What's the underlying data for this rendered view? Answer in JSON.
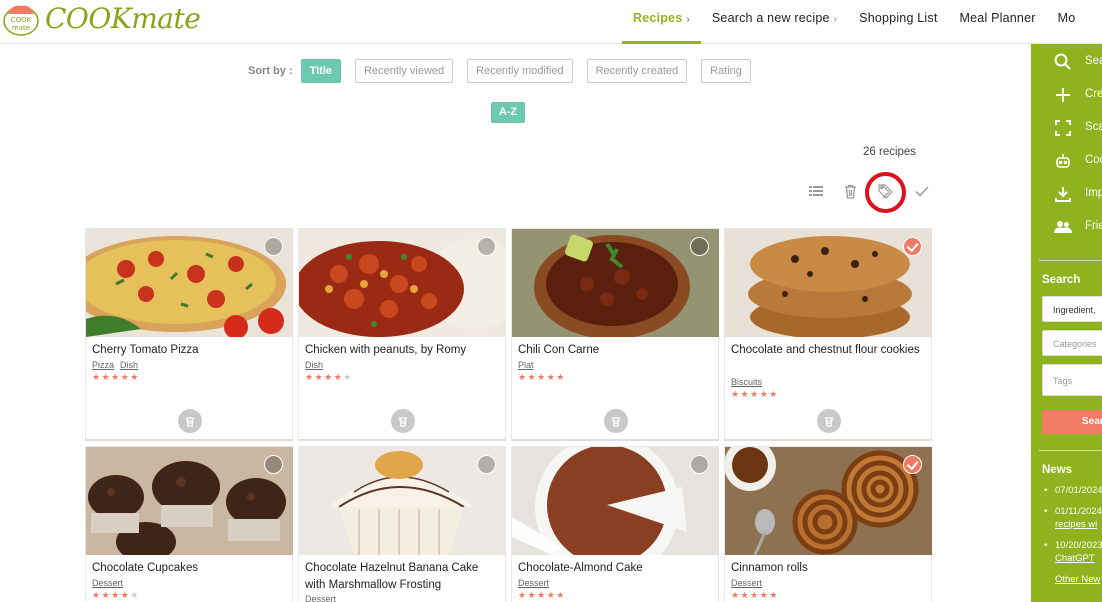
{
  "logo": {
    "badge_top": "COOK",
    "badge_bottom": "mate",
    "text": "COOKmate"
  },
  "nav": [
    {
      "label": "Recipes",
      "chevron": "›"
    },
    {
      "label": "Search a new recipe",
      "chevron": "›"
    },
    {
      "label": "Shopping List",
      "chevron": ""
    },
    {
      "label": "Meal Planner",
      "chevron": ""
    },
    {
      "label": "Mo",
      "chevron": ""
    }
  ],
  "sort": {
    "label": "Sort by :",
    "options": [
      "Title",
      "Recently viewed",
      "Recently modified",
      "Recently created",
      "Rating"
    ],
    "order": "A-Z"
  },
  "recipe_count": "26 recipes",
  "toolbar_icons": [
    "list-view-icon",
    "trash-icon",
    "tag-icon",
    "checkmark-icon"
  ],
  "recipes": [
    {
      "title": "Cherry Tomato Pizza",
      "tags": [
        "Pizza",
        "Dish"
      ],
      "rating": 5,
      "checked": false
    },
    {
      "title": "Chicken with peanuts, by Romy",
      "tags": [
        "Dish"
      ],
      "rating": 4,
      "checked": false
    },
    {
      "title": "Chili Con Carne",
      "tags": [
        "Plat"
      ],
      "rating": 5,
      "checked": false
    },
    {
      "title": "Chocolate and chestnut flour cookies",
      "tags": [
        "Biscuits"
      ],
      "rating": 5,
      "checked": true
    },
    {
      "title": "Chocolate Cupcakes",
      "tags": [
        "Dessert"
      ],
      "rating": 4,
      "checked": false
    },
    {
      "title": "Chocolate Hazelnut Banana Cake with Marshmallow Frosting",
      "tags": [
        "Dessert"
      ],
      "rating": 0,
      "checked": false
    },
    {
      "title": "Chocolate-Almond Cake",
      "tags": [
        "Dessert"
      ],
      "rating": 5,
      "checked": false
    },
    {
      "title": "Cinnamon rolls",
      "tags": [
        "Dessert"
      ],
      "rating": 5,
      "checked": true
    }
  ],
  "sidebar": {
    "items": [
      {
        "icon": "search-icon",
        "label": "Sea"
      },
      {
        "icon": "plus-icon",
        "label": "Cre"
      },
      {
        "icon": "scan-icon",
        "label": "Sca"
      },
      {
        "icon": "robot-icon",
        "label": "Coo"
      },
      {
        "icon": "download-icon",
        "label": "Imp"
      },
      {
        "icon": "friends-icon",
        "label": "Frie"
      }
    ],
    "search_heading": "Search",
    "ingredient_value": "Ingredient,",
    "categories_placeholder": "Categories",
    "tags_placeholder": "Tags",
    "search_button": "Sear",
    "news_heading": "News",
    "news": [
      {
        "date": "07/01/2024",
        "link": ""
      },
      {
        "date": "01/11/2024",
        "link": "recipes wi"
      },
      {
        "date": "10/20/2023",
        "link": "ChatGPT"
      }
    ],
    "other_news": "Other New"
  }
}
